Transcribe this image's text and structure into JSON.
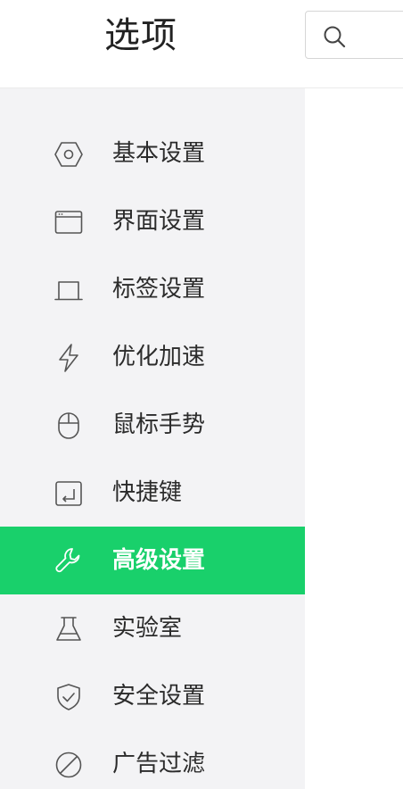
{
  "header": {
    "title": "选项",
    "search": {
      "placeholder": "",
      "value": ""
    }
  },
  "sidebar": {
    "items": [
      {
        "label": "基本设置",
        "icon": "hexagon-settings-icon",
        "active": false
      },
      {
        "label": "界面设置",
        "icon": "window-icon",
        "active": false
      },
      {
        "label": "标签设置",
        "icon": "tab-icon",
        "active": false
      },
      {
        "label": "优化加速",
        "icon": "lightning-icon",
        "active": false
      },
      {
        "label": "鼠标手势",
        "icon": "mouse-icon",
        "active": false
      },
      {
        "label": "快捷键",
        "icon": "shortcut-key-icon",
        "active": false
      },
      {
        "label": "高级设置",
        "icon": "wrench-icon",
        "active": true
      },
      {
        "label": "实验室",
        "icon": "flask-icon",
        "active": false
      },
      {
        "label": "安全设置",
        "icon": "shield-icon",
        "active": false
      },
      {
        "label": "广告过滤",
        "icon": "block-icon",
        "active": false
      }
    ]
  },
  "colors": {
    "accent": "#19d06b",
    "sidebar_bg": "#f3f3f5",
    "text": "#2b2b2b",
    "icon": "#555555"
  }
}
